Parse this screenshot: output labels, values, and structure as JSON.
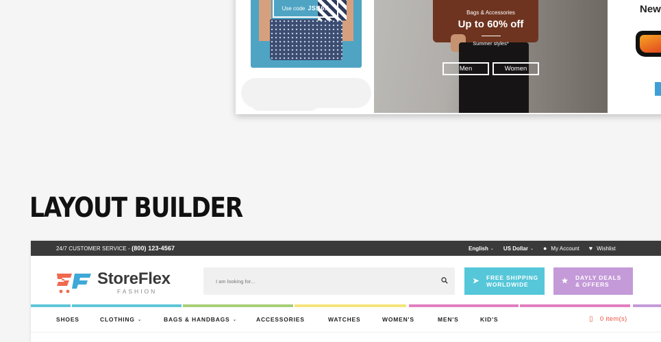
{
  "preview": {
    "left_banner": {
      "code_prefix": "Use code",
      "code": "JSB6X"
    },
    "center_banner": {
      "category": "Bags & Accessories",
      "headline": "Up to 60% off",
      "tagline": "Summer styles*",
      "buttons": [
        "Men",
        "Women"
      ]
    },
    "right_banner": {
      "title": "New"
    }
  },
  "heading": "LAYOUT BUILDER",
  "store": {
    "topbar": {
      "service_label": "24/7 CUSTOMER SERVICE -",
      "phone": "(800) 123-4567",
      "language": "English",
      "currency": "US Dollar",
      "account": "My Account",
      "wishlist": "Wishlist"
    },
    "logo": {
      "brand": "StoreFlex",
      "sub": "FASHION",
      "mark_color_1": "#f0694f",
      "mark_color_2": "#3fa8d8"
    },
    "search": {
      "placeholder": "I am looking for..."
    },
    "promos": [
      {
        "line1": "FREE SHIPPING",
        "line2": "WORLDWIDE",
        "icon": "paper-plane-icon",
        "color": "#55c7d9"
      },
      {
        "line1": "DAYLY DEALS",
        "line2": "& OFFERS",
        "icon": "star-icon",
        "color": "#c49ad8"
      }
    ],
    "colorbar": [
      "#5ec6d8",
      "#5ec6d8",
      "#a8cf76",
      "#f5e37a",
      "#f5e37a",
      "#e27fc0",
      "#e27fc0",
      "#5ec6d8",
      "#c49ad8"
    ],
    "nav": [
      {
        "label": "SHOES",
        "dropdown": false
      },
      {
        "label": "CLOTHING",
        "dropdown": true
      },
      {
        "label": "BAGS & HANDBAGS",
        "dropdown": true
      },
      {
        "label": "ACCESSORIES",
        "dropdown": false
      },
      {
        "label": "WATCHES",
        "dropdown": false
      },
      {
        "label": "WOMEN'S",
        "dropdown": false
      },
      {
        "label": "MEN'S",
        "dropdown": false
      },
      {
        "label": "KID'S",
        "dropdown": false
      }
    ],
    "cart": {
      "label": "0 item(s)"
    }
  }
}
